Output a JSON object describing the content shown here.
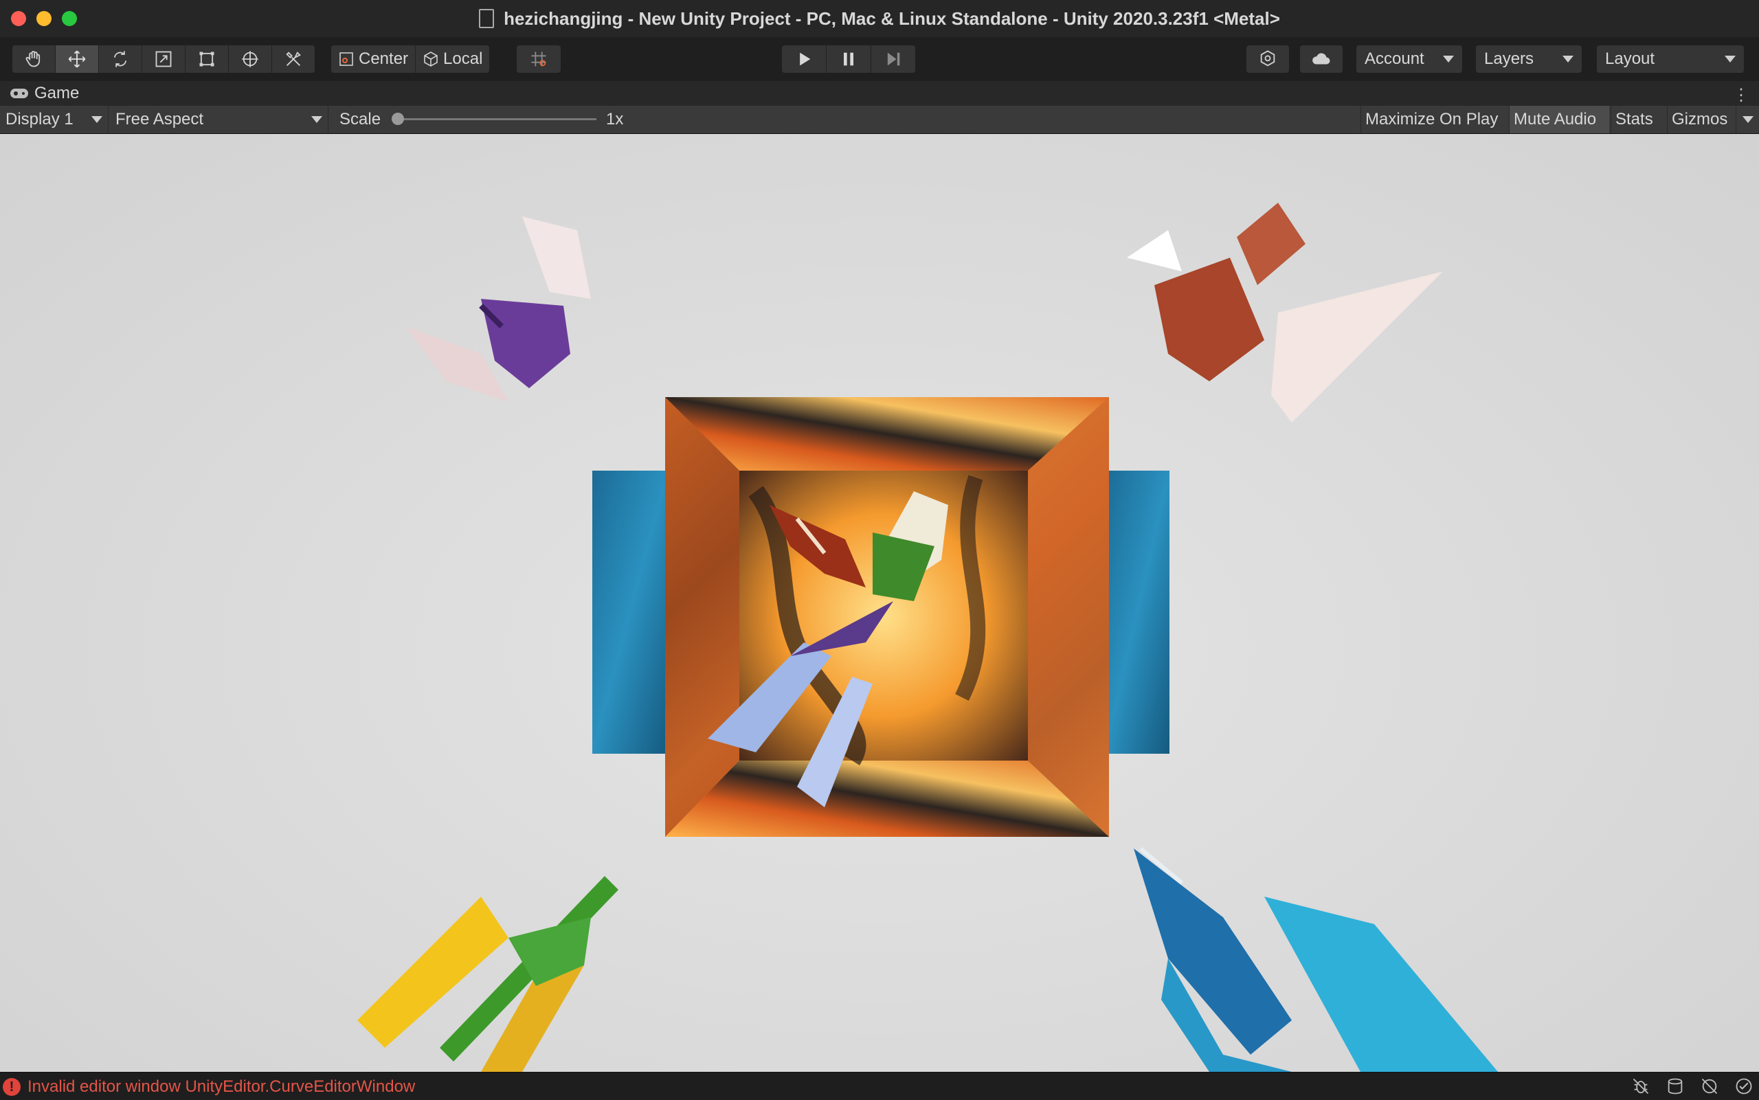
{
  "window": {
    "title": "hezichangjing - New Unity Project - PC, Mac & Linux Standalone - Unity 2020.3.23f1 <Metal>"
  },
  "toolbar": {
    "tools": [
      "hand-tool",
      "move-tool",
      "rotate-tool",
      "scale-tool",
      "rect-tool",
      "transform-tool",
      "custom-tool"
    ],
    "pivot_label": "Center",
    "space_label": "Local",
    "account_label": "Account",
    "layers_label": "Layers",
    "layout_label": "Layout"
  },
  "game_tab": {
    "label": "Game"
  },
  "game_controls": {
    "display_label": "Display 1",
    "aspect_label": "Free Aspect",
    "scale_label": "Scale",
    "scale_value": "1x",
    "maximize_label": "Maximize On Play",
    "mute_label": "Mute Audio",
    "stats_label": "Stats",
    "gizmos_label": "Gizmos"
  },
  "status": {
    "error_text": "Invalid editor window UnityEditor.CurveEditorWindow"
  },
  "colors": {
    "accent_error": "#e45548",
    "close": "#fe5f57",
    "minimize": "#febc2e",
    "maximize": "#28c840"
  }
}
